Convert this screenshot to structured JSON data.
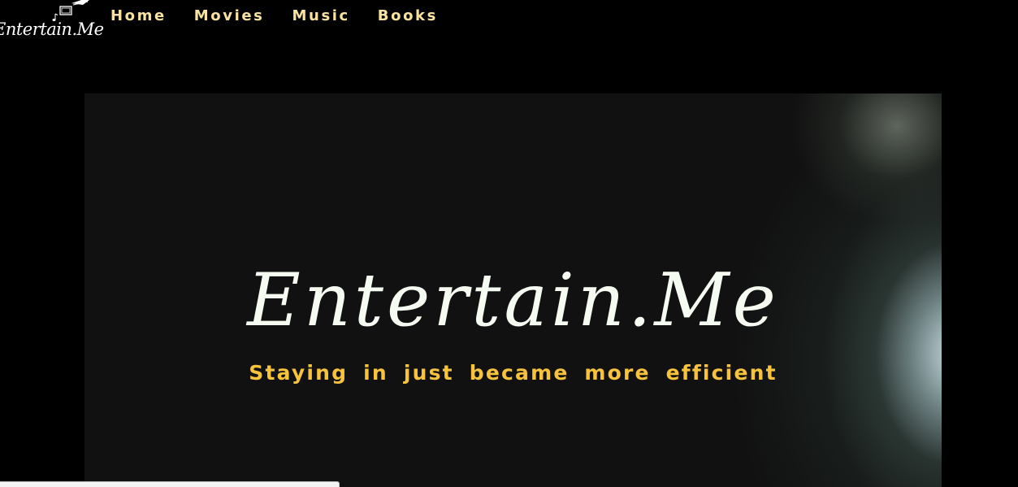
{
  "nav": {
    "logo_text": "Entertain.Me",
    "links": [
      "Home",
      "Movies",
      "Music",
      "Books"
    ]
  },
  "hero": {
    "title": "Entertain.Me",
    "subtitle": "Staying in just became more efficient"
  },
  "colors": {
    "background": "#000000",
    "hero_background": "#111111",
    "nav_link": "#f7e2a1",
    "title": "#f6fbf1",
    "subtitle": "#f7c33c"
  },
  "icons": [
    "film-reel-icon",
    "music-note-icon"
  ]
}
